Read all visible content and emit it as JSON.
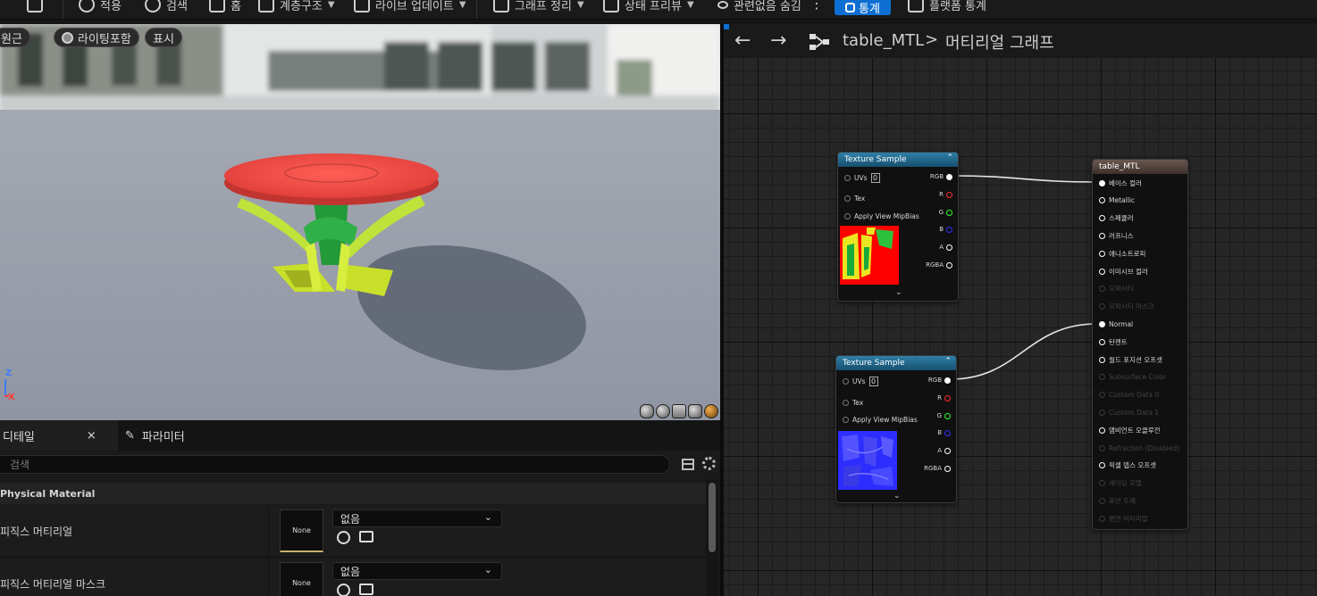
{
  "toolbar": {
    "items": [
      {
        "label": "적용",
        "icon": "apply-icon"
      },
      {
        "label": "검색",
        "icon": "search-icon"
      },
      {
        "label": "홈",
        "icon": "home-icon"
      },
      {
        "label": "계층구조",
        "icon": "hierarchy-icon"
      },
      {
        "label": "라이브 업데이트",
        "icon": "live-update-icon"
      },
      {
        "label": "그래프 정리",
        "icon": "clean-graph-icon"
      },
      {
        "label": "상태 프리뷰",
        "icon": "preview-state-icon"
      },
      {
        "label": "관련없음 숨김",
        "icon": "eye-icon"
      }
    ],
    "stats_label": "통계",
    "platform_stats_label": "플랫폼 통계"
  },
  "viewport": {
    "pills": [
      "원근",
      "라이팅포함",
      "표시"
    ],
    "axis_z": "Z",
    "axis_x": "X"
  },
  "details": {
    "tab_details": "디테일",
    "tab_close": "×",
    "tab_parameters": "파라미터",
    "search_placeholder": "검색",
    "category": "Physical Material",
    "rows": [
      {
        "label": "피직스 머티리얼",
        "thumb": "None",
        "value": "없음"
      },
      {
        "label": "피직스 머티리얼 마스크",
        "thumb": "None",
        "value": "없음"
      }
    ]
  },
  "graph": {
    "crumb_asset": "table_MTL",
    "crumb_sep": ">",
    "crumb_graph": "머티리얼 그래프",
    "texture_nodes": [
      {
        "title": "Texture Sample",
        "inputs": [
          "UVs",
          "Tex",
          "Apply View MipBias"
        ],
        "uvs_value": "0",
        "outputs": [
          "RGB",
          "R",
          "G",
          "B",
          "A",
          "RGBA"
        ]
      },
      {
        "title": "Texture Sample",
        "inputs": [
          "UVs",
          "Tex",
          "Apply View MipBias"
        ],
        "uvs_value": "0",
        "outputs": [
          "RGB",
          "R",
          "G",
          "B",
          "A",
          "RGBA"
        ]
      }
    ],
    "material_node": {
      "title": "table_MTL",
      "pins": [
        {
          "label": "베이스 컬러",
          "active": true,
          "connected": true
        },
        {
          "label": "Metallic",
          "active": true,
          "connected": false
        },
        {
          "label": "스페큘러",
          "active": true,
          "connected": false
        },
        {
          "label": "러프니스",
          "active": true,
          "connected": false
        },
        {
          "label": "애니소트로피",
          "active": true,
          "connected": false
        },
        {
          "label": "이미시브 컬러",
          "active": true,
          "connected": false
        },
        {
          "label": "오파시티",
          "active": false,
          "connected": false
        },
        {
          "label": "오파시티 마스크",
          "active": false,
          "connected": false
        },
        {
          "label": "Normal",
          "active": true,
          "connected": true
        },
        {
          "label": "탄젠트",
          "active": true,
          "connected": false
        },
        {
          "label": "월드 포지션 오프셋",
          "active": true,
          "connected": false
        },
        {
          "label": "Subsurface Color",
          "active": false,
          "connected": false
        },
        {
          "label": "Custom Data 0",
          "active": false,
          "connected": false
        },
        {
          "label": "Custom Data 1",
          "active": false,
          "connected": false
        },
        {
          "label": "앰비언트 오클루전",
          "active": true,
          "connected": false
        },
        {
          "label": "Refraction (Disabled)",
          "active": false,
          "connected": false
        },
        {
          "label": "픽셀 뎁스 오프셋",
          "active": true,
          "connected": false
        },
        {
          "label": "셰이딩 모델",
          "active": false,
          "connected": false
        },
        {
          "label": "표면 두께",
          "active": false,
          "connected": false
        },
        {
          "label": "평면 머티리얼",
          "active": false,
          "connected": false
        }
      ]
    }
  },
  "colors": {
    "accent": "#0d6fd1",
    "pin_r": "#ff3030",
    "pin_g": "#30ff30",
    "pin_b": "#3030ff"
  }
}
